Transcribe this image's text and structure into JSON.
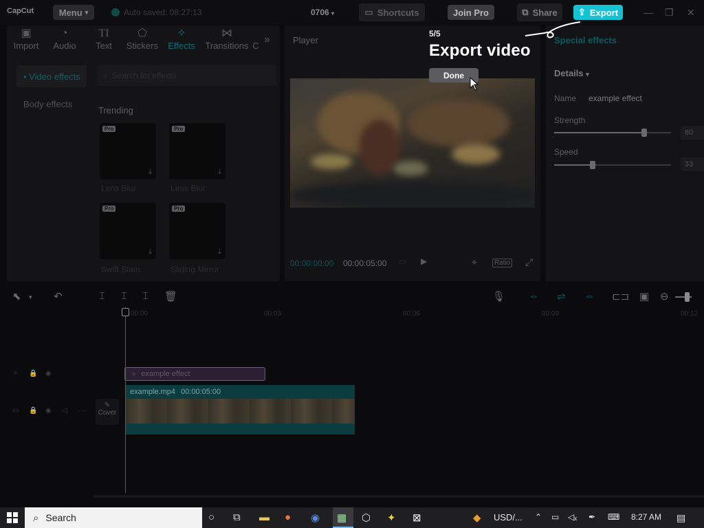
{
  "titlebar": {
    "logo": "CapCut",
    "menu_label": "Menu",
    "autosave_text": "Auto saved: 08:27:13",
    "project_name": "0706",
    "shortcuts_label": "Shortcuts",
    "joinpro_label": "Join Pro",
    "share_label": "Share",
    "export_label": "Export"
  },
  "media_tabs": [
    {
      "label": "Import",
      "icon": "import-icon"
    },
    {
      "label": "Audio",
      "icon": "audio-icon"
    },
    {
      "label": "Text",
      "icon": "text-icon"
    },
    {
      "label": "Stickers",
      "icon": "stickers-icon"
    },
    {
      "label": "Effects",
      "icon": "effects-icon",
      "active": true
    },
    {
      "label": "Transitions",
      "icon": "transitions-icon"
    },
    {
      "label": "C",
      "icon": "more-icon"
    }
  ],
  "side_nav": [
    "• Video effects",
    "Body effects"
  ],
  "search": {
    "placeholder": "Search for effects"
  },
  "section_title": "Trending",
  "effects": [
    {
      "label": "Lens Blur",
      "badge": "Pro"
    },
    {
      "label": "Lens Blur",
      "badge": "Pro"
    },
    {
      "label": "Swift Slam",
      "badge": "Pro"
    },
    {
      "label": "Sliding Mirror",
      "badge": "Pro"
    }
  ],
  "player": {
    "title": "Player",
    "current_time": "00:00:00:00",
    "total_time": "00:00:05:00",
    "ratio_label": "Ratio"
  },
  "right_panel": {
    "title": "Special effects",
    "details_label": "Details",
    "name_label": "Name",
    "name_value": "example effect",
    "strength_label": "Strength",
    "strength_value": "80",
    "strength_fraction": 0.8,
    "speed_label": "Speed",
    "speed_value": "33",
    "speed_fraction": 0.33
  },
  "timeline": {
    "ruler": [
      "00:00",
      "00:03",
      "00:06",
      "00:09",
      "00:12"
    ],
    "effect_clip": "example effect",
    "video_clip_name": "example.mp4",
    "video_clip_duration": "00:00:05:00",
    "cover_label": "Cover"
  },
  "tour": {
    "step": "5/5",
    "title": "Export video",
    "done_label": "Done"
  },
  "taskbar": {
    "search_label": "Search",
    "currency": "USD/...",
    "time": "8:27 AM"
  },
  "colors": {
    "accent": "#13c3d3",
    "background": "#0b0b0d"
  }
}
